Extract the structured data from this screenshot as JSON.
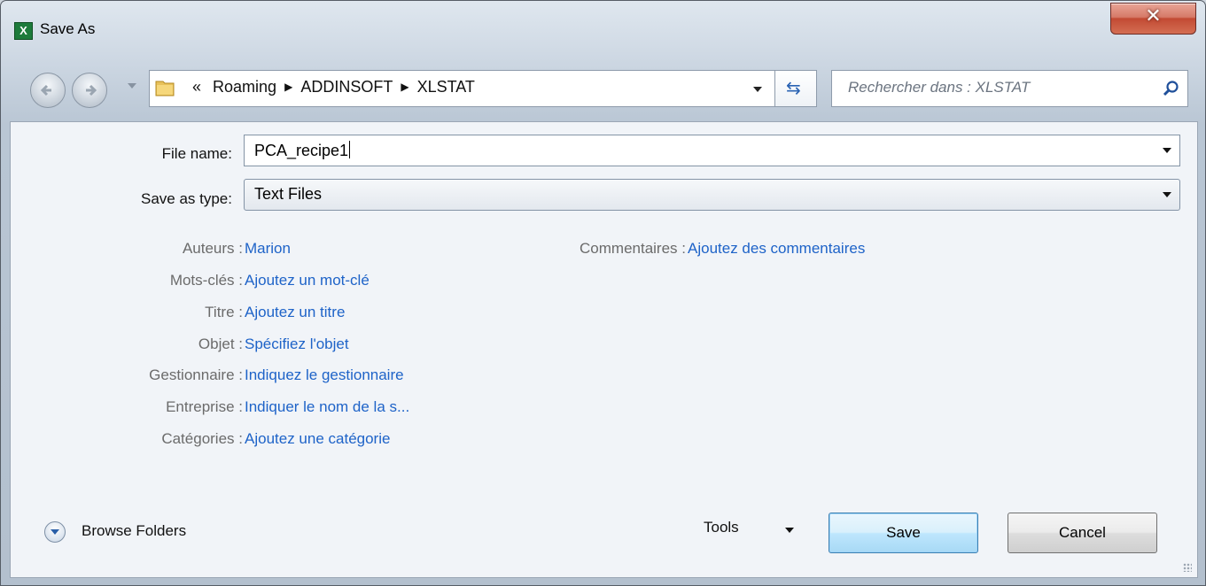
{
  "window": {
    "title": "Save As",
    "app_icon": "X"
  },
  "toolbar": {
    "breadcrumb": {
      "prefix": "«",
      "items": [
        "Roaming",
        "ADDINSOFT",
        "XLSTAT"
      ]
    },
    "search_placeholder": "Rechercher dans : XLSTAT"
  },
  "form": {
    "file_name_label": "File name:",
    "file_name_value": "PCA_recipe1",
    "save_type_label": "Save as type:",
    "save_type_value": "Text Files"
  },
  "metadata": {
    "left": [
      {
        "key": "Auteurs :",
        "value": "Marion"
      },
      {
        "key": "Mots-clés :",
        "value": "Ajoutez un mot-clé"
      },
      {
        "key": "Titre :",
        "value": "Ajoutez un titre"
      },
      {
        "key": "Objet :",
        "value": "Spécifiez l'objet"
      },
      {
        "key": "Gestionnaire :",
        "value": "Indiquez le gestionnaire"
      },
      {
        "key": "Entreprise :",
        "value": "Indiquer le nom de la s..."
      },
      {
        "key": "Catégories :",
        "value": "Ajoutez une catégorie"
      }
    ],
    "right": [
      {
        "key": "Commentaires :",
        "value": "Ajoutez des commentaires"
      }
    ]
  },
  "footer": {
    "browse_label": "Browse Folders",
    "tools_label": "Tools",
    "save_label": "Save",
    "cancel_label": "Cancel"
  },
  "icons": {
    "close": "close-icon",
    "back": "back-arrow-icon",
    "forward": "forward-arrow-icon",
    "folder": "folder-icon",
    "refresh": "refresh-icon",
    "search": "search-icon",
    "expand": "chevron-down-icon"
  },
  "colors": {
    "link": "#1e63c8",
    "close": "#c24a33",
    "accent": "#3c7fb1"
  }
}
